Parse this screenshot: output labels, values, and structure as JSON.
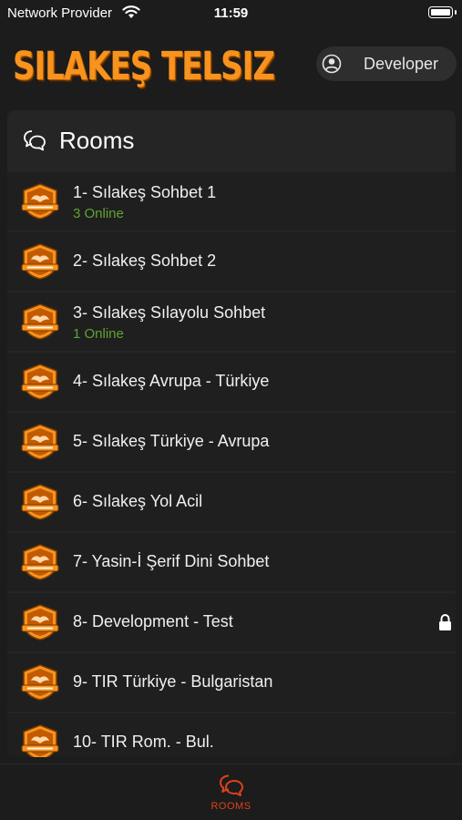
{
  "status_bar": {
    "carrier": "Network Provider",
    "time": "11:59",
    "wifi_icon": "wifi-icon",
    "battery_icon": "battery-icon"
  },
  "header": {
    "logo_text": "SILAKEŞ TELSIZ",
    "user_name": "Developer",
    "user_icon": "user-circle-icon",
    "brand_color": "#f7931e"
  },
  "rooms": {
    "title": "Rooms",
    "title_icon": "chat-bubbles-icon",
    "online_color": "#5fa334",
    "items": [
      {
        "name": "1- Sılakeş Sohbet 1",
        "online": "3 Online",
        "locked": false
      },
      {
        "name": "2- Sılakeş Sohbet 2",
        "online": "",
        "locked": false
      },
      {
        "name": "3- Sılakeş Sılayolu Sohbet",
        "online": "1 Online",
        "locked": false
      },
      {
        "name": "4- Sılakeş Avrupa - Türkiye",
        "online": "",
        "locked": false
      },
      {
        "name": "5- Sılakeş Türkiye - Avrupa",
        "online": "",
        "locked": false
      },
      {
        "name": "6- Sılakeş Yol Acil",
        "online": "",
        "locked": false
      },
      {
        "name": "7- Yasin-İ Şerif Dini Sohbet",
        "online": "",
        "locked": false
      },
      {
        "name": "8- Development - Test",
        "online": "",
        "locked": true
      },
      {
        "name": "9- TIR Türkiye - Bulgaristan",
        "online": "",
        "locked": false
      },
      {
        "name": "10- TIR Rom. - Bul.",
        "online": "",
        "locked": false
      }
    ]
  },
  "tab_bar": {
    "rooms_label": "ROOMS",
    "rooms_icon": "chat-bubbles-icon",
    "active_color": "#e0401b"
  }
}
